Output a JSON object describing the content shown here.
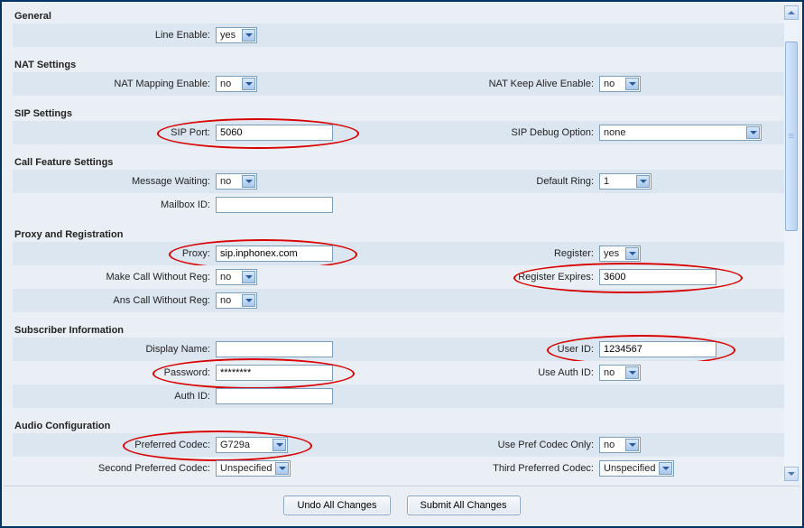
{
  "sections": {
    "general": {
      "title": "General",
      "line_enable": {
        "label": "Line Enable:",
        "value": "yes"
      }
    },
    "nat": {
      "title": "NAT Settings",
      "nat_mapping_enable": {
        "label": "NAT Mapping Enable:",
        "value": "no"
      },
      "nat_keep_alive_enable": {
        "label": "NAT Keep Alive Enable:",
        "value": "no"
      }
    },
    "sip": {
      "title": "SIP Settings",
      "sip_port": {
        "label": "SIP Port:",
        "value": "5060"
      },
      "sip_debug_option": {
        "label": "SIP Debug Option:",
        "value": "none"
      }
    },
    "call_feature": {
      "title": "Call Feature Settings",
      "message_waiting": {
        "label": "Message Waiting:",
        "value": "no"
      },
      "default_ring": {
        "label": "Default Ring:",
        "value": "1"
      },
      "mailbox_id": {
        "label": "Mailbox ID:",
        "value": ""
      }
    },
    "proxy": {
      "title": "Proxy and Registration",
      "proxy": {
        "label": "Proxy:",
        "value": "sip.inphonex.com"
      },
      "register": {
        "label": "Register:",
        "value": "yes"
      },
      "make_call_without_reg": {
        "label": "Make Call Without Reg:",
        "value": "no"
      },
      "register_expires": {
        "label": "Register Expires:",
        "value": "3600"
      },
      "ans_call_without_reg": {
        "label": "Ans Call Without Reg:",
        "value": "no"
      }
    },
    "subscriber": {
      "title": "Subscriber Information",
      "display_name": {
        "label": "Display Name:",
        "value": ""
      },
      "user_id": {
        "label": "User ID:",
        "value": "1234567"
      },
      "password": {
        "label": "Password:",
        "value": "********"
      },
      "use_auth_id": {
        "label": "Use Auth ID:",
        "value": "no"
      },
      "auth_id": {
        "label": "Auth ID:",
        "value": ""
      }
    },
    "audio": {
      "title": "Audio Configuration",
      "preferred_codec": {
        "label": "Preferred Codec:",
        "value": "G729a"
      },
      "use_pref_codec_only": {
        "label": "Use Pref Codec Only:",
        "value": "no"
      },
      "second_preferred_codec": {
        "label": "Second Preferred Codec:",
        "value": "Unspecified"
      },
      "third_preferred_codec": {
        "label": "Third Preferred Codec:",
        "value": "Unspecified"
      }
    }
  },
  "footer": {
    "undo": "Undo All Changes",
    "submit": "Submit All Changes"
  }
}
